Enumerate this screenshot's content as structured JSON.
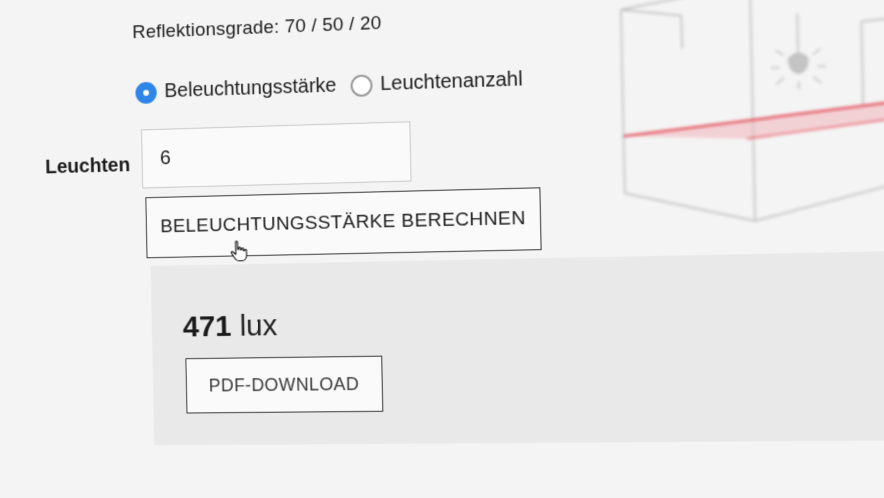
{
  "reflection_label": "Reflektionsgrade: 70 / 50 / 20",
  "mode": {
    "options": [
      {
        "label": "Beleuchtungsstärke",
        "selected": true
      },
      {
        "label": "Leuchtenanzahl",
        "selected": false
      }
    ]
  },
  "luminaires": {
    "label": "Leuchten",
    "value": "6"
  },
  "calculate_button": "BELEUCHTUNGSSTÄRKE BERECHNEN",
  "result": {
    "value": "471",
    "unit": "lux"
  },
  "pdf_button": "PDF-DOWNLOAD",
  "colors": {
    "accent": "#2f86e9",
    "laser": "#e23a48"
  },
  "icons": {
    "cursor": "hand-pointer-icon",
    "illustration": "room-lamp-illustration"
  }
}
